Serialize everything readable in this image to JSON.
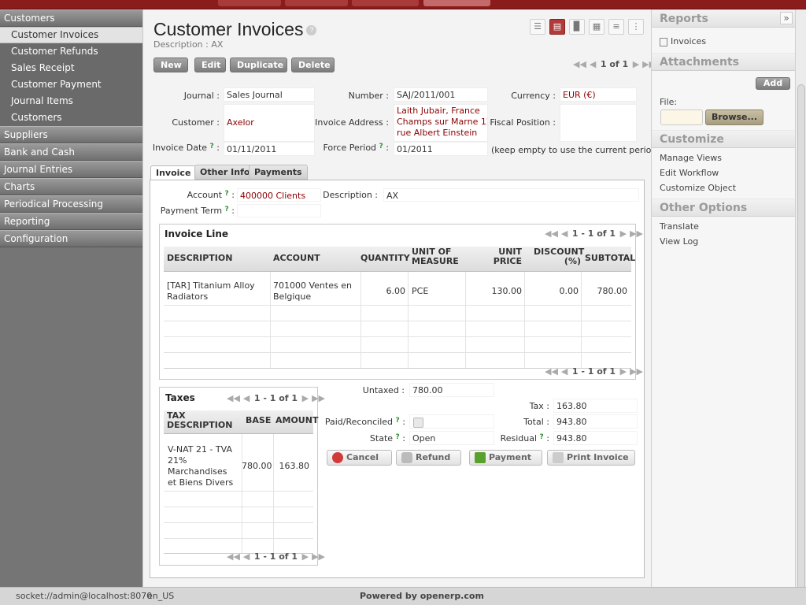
{
  "sidebar": {
    "sections": [
      {
        "label": "Customers",
        "items": [
          "Customer Invoices",
          "Customer Refunds",
          "Sales Receipt",
          "Customer Payment",
          "Journal Items",
          "Customers"
        ]
      },
      {
        "label": "Suppliers"
      },
      {
        "label": "Bank and Cash"
      },
      {
        "label": "Journal Entries"
      },
      {
        "label": "Charts"
      },
      {
        "label": "Periodical Processing"
      },
      {
        "label": "Reporting"
      },
      {
        "label": "Configuration"
      }
    ]
  },
  "header": {
    "title": "Customer Invoices",
    "help": "?",
    "description": "Description : AX"
  },
  "views": [
    "list-view-icon",
    "form-view-icon",
    "graph-view-icon",
    "calendar-view-icon",
    "gantt-view-icon",
    "diagram-view-icon"
  ],
  "toolbar": {
    "new": "New",
    "edit": "Edit",
    "duplicate": "Duplicate",
    "delete": "Delete",
    "pager": "1 of 1"
  },
  "form": {
    "journal_label": "Journal :",
    "journal": "Sales Journal",
    "number_label": "Number :",
    "number": "SAJ/2011/001",
    "currency_label": "Currency :",
    "currency": "EUR (€)",
    "customer_label": "Customer :",
    "customer": "Axelor",
    "address_label": "Invoice Address :",
    "address": [
      "Laith Jubair, France",
      "Champs sur Marne 12",
      "rue Albert Einstein"
    ],
    "fiscal_label": "Fiscal Position :",
    "date_label": "Invoice Date",
    "date": "01/11/2011",
    "period_label": "Force Period",
    "period": "01/2011",
    "period_hint": "(keep empty to use the current period)",
    "q": "?",
    "colon": ":"
  },
  "tabs": [
    "Invoice",
    "Other Info",
    "Payments"
  ],
  "invoice_tab": {
    "account_label": "Account",
    "account": "400000 Clients",
    "desc_label": "Description :",
    "desc": "AX",
    "payterm_label": "Payment Term"
  },
  "invoice_lines": {
    "title": "Invoice Line",
    "pager": "1 - 1 of 1",
    "headers": {
      "description": "DESCRIPTION",
      "account": "ACCOUNT",
      "quantity": "QUANTITY",
      "uom": "UNIT OF MEASURE",
      "unit_price": "UNIT PRICE",
      "discount": "DISCOUNT (%)",
      "subtotal": "SUBTOTAL"
    },
    "rows": [
      {
        "description": "[TAR] Titanium Alloy Radiators",
        "account": "701000 Ventes en Belgique",
        "quantity": "6.00",
        "uom": "PCE",
        "unit_price": "130.00",
        "discount": "0.00",
        "subtotal": "780.00"
      }
    ]
  },
  "taxes": {
    "title": "Taxes",
    "pager": "1 - 1 of 1",
    "headers": {
      "description": "TAX DESCRIPTION",
      "base": "BASE",
      "amount": "AMOUNT"
    },
    "rows": [
      {
        "description": "V-NAT 21 - TVA 21% Marchandises et Biens Divers",
        "base": "780.00",
        "amount": "163.80"
      }
    ]
  },
  "totals": {
    "untaxed_label": "Untaxed :",
    "untaxed": "780.00",
    "tax_label": "Tax :",
    "tax": "163.80",
    "total_label": "Total :",
    "total": "943.80",
    "paid_label": "Paid/Reconciled",
    "state_label": "State",
    "state": "Open",
    "residual_label": "Residual",
    "residual": "943.80"
  },
  "actions": {
    "cancel": "Cancel",
    "refund": "Refund",
    "payment": "Payment",
    "print": "Print Invoice"
  },
  "right_panel": {
    "collapse": "»",
    "reports_title": "Reports",
    "reports_item": "Invoices",
    "attachments_title": "Attachments",
    "add": "Add",
    "file_label": "File:",
    "browse": "Browse...",
    "customize_title": "Customize",
    "customize_items": [
      "Manage Views",
      "Edit Workflow",
      "Customize Object"
    ],
    "other_title": "Other Options",
    "other_items": [
      "Translate",
      "View Log"
    ]
  },
  "footer": {
    "socket": "socket://admin@localhost:8070",
    "lang": "en_US",
    "powered": "Powered by openerp.com"
  },
  "colors": {
    "brand": "#8b1c1c",
    "sidebar": "#757575",
    "link_red": "#8b0000"
  }
}
